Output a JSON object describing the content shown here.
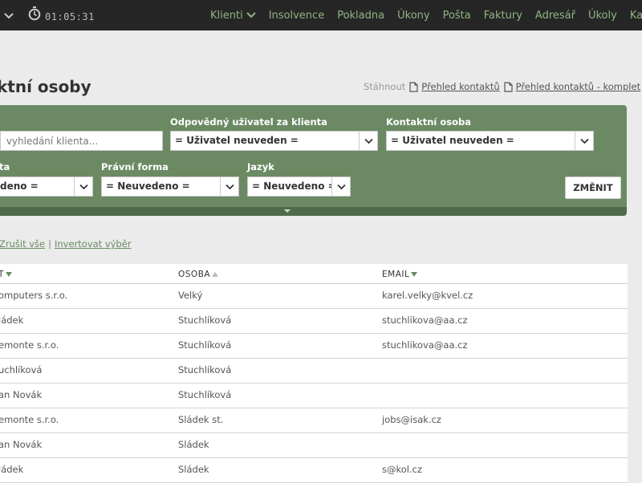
{
  "topbar": {
    "timer": "01:05:31",
    "nav": [
      "Klienti",
      "Insolvence",
      "Pokladna",
      "Úkony",
      "Pošta",
      "Faktury",
      "Adresář",
      "Úkoly",
      "Kalendář"
    ]
  },
  "page": {
    "title": "ktní osoby",
    "download_label": "Stáhnout",
    "download_links": [
      "Přehled kontaktů",
      "Přehled kontaktů - komplet"
    ]
  },
  "filters": {
    "search_placeholder": " vyhledání klienta...",
    "responsible_label": "Odpovědný uživatel za klienta",
    "responsible_value": "= Uživatel neuveden =",
    "contact_label": "Kontaktní osoba",
    "contact_value": "= Uživatel neuveden =",
    "status_label": "ta",
    "status_value": "deno =",
    "legal_form_label": "Právní forma",
    "legal_form_value": "= Neuvedeno =",
    "language_label": "Jazyk",
    "language_value": "= Neuvedeno =",
    "change_button": "ZMĚNIT"
  },
  "bulk": {
    "cancel_all": "Zrušit vše",
    "separator": "|",
    "invert": "Invertovat výběr"
  },
  "table": {
    "headers": [
      "T",
      "OSOBA",
      "EMAIL"
    ],
    "rows": [
      [
        "omputers s.r.o.",
        "Velký",
        "karel.velky@kvel.cz"
      ],
      [
        "ládek",
        "Stuchlíková",
        "stuchlikova@aa.cz"
      ],
      [
        "emonte s.r.o.",
        "Stuchlíková",
        "stuchlikova@aa.cz"
      ],
      [
        "uchlíková",
        "Stuchlíková",
        ""
      ],
      [
        "an Novák",
        "Stuchlíková",
        ""
      ],
      [
        "emonte s.r.o.",
        "Sládek st.",
        "jobs@isak.cz"
      ],
      [
        "an Novák",
        "Sládek",
        ""
      ],
      [
        "ládek",
        "Sládek",
        "s@kol.cz"
      ]
    ]
  },
  "colors": {
    "topbar": "#262626",
    "nav_link": "#8fb582",
    "filter_panel": "#6b8a64",
    "filter_strip": "#4f6b49",
    "background": "#ebebeb"
  }
}
